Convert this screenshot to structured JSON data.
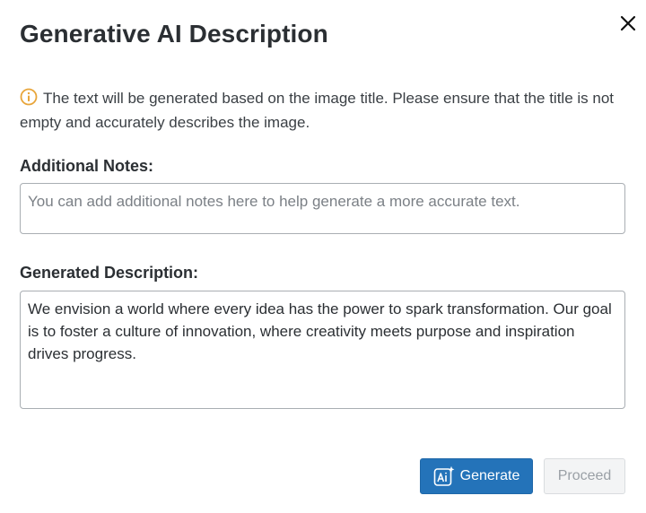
{
  "dialog": {
    "title": "Generative AI Description",
    "close_icon": "close-icon"
  },
  "info": {
    "icon": "info-icon",
    "icon_color": "#e8a53a",
    "text": "The text will be generated based on the image title. Please ensure that the title is not empty and accurately describes the image."
  },
  "additional_notes": {
    "label": "Additional Notes:",
    "value": "",
    "placeholder": "You can add additional notes here to help generate a more accurate text."
  },
  "generated_description": {
    "label": "Generated Description:",
    "value": "We envision a world where every idea has the power to spark transformation. Our goal is to foster a culture of innovation, where creativity meets purpose and inspiration drives progress."
  },
  "actions": {
    "generate_label": "Generate",
    "generate_icon": "ai-sparkle-icon",
    "proceed_label": "Proceed",
    "primary_color": "#2473b9"
  }
}
